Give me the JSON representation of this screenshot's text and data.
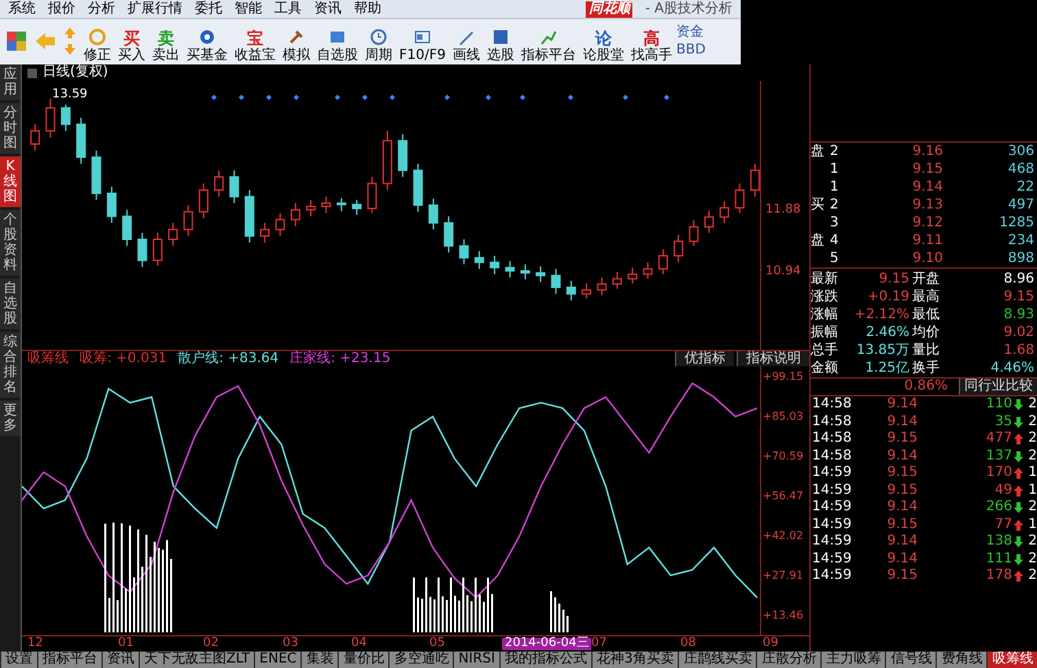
{
  "menu": [
    "系统",
    "报价",
    "分析",
    "扩展行情",
    "委托",
    "智能",
    "工具",
    "资讯",
    "帮助"
  ],
  "logo": "同花顺",
  "app_title": "- A股技术分析",
  "toolbar": [
    {
      "label": "修正"
    },
    {
      "label": "买入",
      "glyph": "买",
      "color": "#e02020"
    },
    {
      "label": "卖出",
      "glyph": "卖",
      "color": "#20a020"
    },
    {
      "label": "买基金"
    },
    {
      "label": "收益宝",
      "glyph": "宝",
      "color": "#e02020"
    },
    {
      "label": "模拟"
    },
    {
      "label": "自选股"
    },
    {
      "label": "周期"
    },
    {
      "label": "F10/F9"
    },
    {
      "label": "画线"
    },
    {
      "label": "选股"
    },
    {
      "label": "指标平台"
    },
    {
      "label": "论股堂",
      "glyph": "论",
      "color": "#2060c0"
    },
    {
      "label": "找高手",
      "glyph": "高",
      "color": "#d01010"
    }
  ],
  "toolbar_cut": [
    "资金",
    "BBD"
  ],
  "side_tabs": [
    {
      "label": "应用",
      "selected": false
    },
    {
      "label": "分时图",
      "selected": false
    },
    {
      "label": "K线图",
      "selected": true
    },
    {
      "label": "个股资料",
      "selected": false
    },
    {
      "label": "自选股",
      "selected": false
    },
    {
      "label": "综合排名",
      "selected": false
    },
    {
      "label": "更多",
      "selected": false
    }
  ],
  "price_chart": {
    "title": "日线(复权)",
    "high_label": "13.59",
    "chart_data": {
      "type": "candlestick",
      "ylim": [
        9.77,
        13.86
      ],
      "yticks": [
        {
          "value": 11.88,
          "label": "11.88"
        },
        {
          "value": 10.94,
          "label": "10.94"
        }
      ],
      "ohlc": [
        [
          12.9,
          13.2,
          12.8,
          13.1
        ],
        [
          13.1,
          13.59,
          13.0,
          13.45
        ],
        [
          13.45,
          13.5,
          13.1,
          13.2
        ],
        [
          13.2,
          13.3,
          12.6,
          12.7
        ],
        [
          12.7,
          12.8,
          12.05,
          12.15
        ],
        [
          12.15,
          12.25,
          11.7,
          11.8
        ],
        [
          11.8,
          11.9,
          11.35,
          11.45
        ],
        [
          11.45,
          11.55,
          11.03,
          11.13
        ],
        [
          11.13,
          11.55,
          11.05,
          11.45
        ],
        [
          11.45,
          11.7,
          11.35,
          11.6
        ],
        [
          11.6,
          11.97,
          11.5,
          11.87
        ],
        [
          11.87,
          12.3,
          11.77,
          12.2
        ],
        [
          12.2,
          12.5,
          12.1,
          12.4
        ],
        [
          12.4,
          12.5,
          12.0,
          12.1
        ],
        [
          12.1,
          12.2,
          11.4,
          11.5
        ],
        [
          11.5,
          11.7,
          11.4,
          11.6
        ],
        [
          11.6,
          11.85,
          11.5,
          11.75
        ],
        [
          11.75,
          12.0,
          11.65,
          11.9
        ],
        [
          11.9,
          12.05,
          11.8,
          11.95
        ],
        [
          11.95,
          12.1,
          11.85,
          12.0
        ],
        [
          12.0,
          12.08,
          11.88,
          11.98
        ],
        [
          11.98,
          12.05,
          11.82,
          11.92
        ],
        [
          11.92,
          12.4,
          11.85,
          12.3
        ],
        [
          12.3,
          13.1,
          12.2,
          12.95
        ],
        [
          12.95,
          13.05,
          12.4,
          12.5
        ],
        [
          12.5,
          12.6,
          11.87,
          11.97
        ],
        [
          11.97,
          12.07,
          11.6,
          11.7
        ],
        [
          11.7,
          11.8,
          11.25,
          11.35
        ],
        [
          11.35,
          11.45,
          11.07,
          11.17
        ],
        [
          11.17,
          11.27,
          11.0,
          11.1
        ],
        [
          11.1,
          11.2,
          10.92,
          11.02
        ],
        [
          11.02,
          11.12,
          10.87,
          10.97
        ],
        [
          10.97,
          11.07,
          10.84,
          10.94
        ],
        [
          10.94,
          11.04,
          10.8,
          10.9
        ],
        [
          10.9,
          11.0,
          10.62,
          10.72
        ],
        [
          10.72,
          10.82,
          10.52,
          10.62
        ],
        [
          10.62,
          10.78,
          10.55,
          10.68
        ],
        [
          10.68,
          10.87,
          10.6,
          10.77
        ],
        [
          10.77,
          10.95,
          10.7,
          10.85
        ],
        [
          10.85,
          11.02,
          10.78,
          10.92
        ],
        [
          10.92,
          11.1,
          10.85,
          11.0
        ],
        [
          11.0,
          11.3,
          10.92,
          11.2
        ],
        [
          11.2,
          11.52,
          11.1,
          11.42
        ],
        [
          11.42,
          11.74,
          11.35,
          11.64
        ],
        [
          11.64,
          11.89,
          11.55,
          11.79
        ],
        [
          11.79,
          12.03,
          11.7,
          11.93
        ],
        [
          11.93,
          12.3,
          11.85,
          12.2
        ],
        [
          12.2,
          12.6,
          12.1,
          12.5
        ]
      ]
    }
  },
  "indicator": {
    "name": "吸筹线",
    "values": [
      {
        "name": "吸筹:",
        "value": "+0.031",
        "color": "#e03030"
      },
      {
        "name": "散户线:",
        "value": "+83.64",
        "color": "#60e0e0"
      },
      {
        "name": "庄家线:",
        "value": "+23.15",
        "color": "#e040e0"
      }
    ],
    "buttons": [
      "优指标",
      "指标说明"
    ],
    "chart_data": {
      "type": "line",
      "ylim": [
        6.56,
        103.09
      ],
      "yticks": [
        {
          "value": 99.15,
          "label": "+99.15"
        },
        {
          "value": 85.03,
          "label": "+85.03"
        },
        {
          "value": 70.59,
          "label": "+70.59"
        },
        {
          "value": 56.47,
          "label": "+56.47"
        },
        {
          "value": 42.02,
          "label": "+42.02"
        },
        {
          "value": 27.91,
          "label": "+27.91"
        },
        {
          "value": 13.46,
          "label": "+13.46"
        }
      ],
      "series": [
        {
          "color": "#60e0e0",
          "values": [
            60,
            52,
            55,
            70,
            95,
            90,
            92,
            60,
            52,
            45,
            70,
            85,
            75,
            50,
            45,
            35,
            25,
            40,
            80,
            85,
            70,
            60,
            75,
            88,
            90,
            88,
            80,
            60,
            32,
            38,
            28,
            30,
            38,
            28,
            20
          ]
        },
        {
          "color": "#d040d0",
          "values": [
            55,
            65,
            60,
            42,
            28,
            22,
            32,
            58,
            78,
            92,
            96,
            82,
            62,
            46,
            32,
            25,
            28,
            40,
            55,
            38,
            27,
            20,
            28,
            42,
            60,
            75,
            88,
            92,
            82,
            72,
            85,
            97,
            92,
            85,
            88
          ]
        }
      ]
    }
  },
  "x_axis": [
    {
      "label": "12",
      "selected": false
    },
    {
      "label": "01",
      "selected": false
    },
    {
      "label": "02",
      "selected": false
    },
    {
      "label": "03",
      "selected": false
    },
    {
      "label": "04",
      "selected": false
    },
    {
      "label": "05",
      "selected": false
    },
    {
      "label": "2014-06-04三",
      "selected": true
    },
    {
      "label": "07",
      "selected": false
    },
    {
      "label": "08",
      "selected": false
    },
    {
      "label": "09",
      "selected": false
    }
  ],
  "order_book": [
    {
      "side_label": "盘",
      "level": "2",
      "price": "9.16",
      "volume": "306"
    },
    {
      "level": "1",
      "price": "9.15",
      "volume": "468"
    },
    {
      "level": "1",
      "price": "9.14",
      "volume": "22"
    },
    {
      "side_label": "买",
      "level": "2",
      "price": "9.13",
      "volume": "497"
    },
    {
      "level": "3",
      "price": "9.12",
      "volume": "1285"
    },
    {
      "side_label": "盘",
      "level": "4",
      "price": "9.11",
      "volume": "234"
    },
    {
      "level": "5",
      "price": "9.10",
      "volume": "898"
    }
  ],
  "stats": [
    {
      "label": "最新",
      "value": "9.15",
      "color": "#e04040"
    },
    {
      "label": "开盘",
      "value": "8.96",
      "color": "#ffffff"
    },
    {
      "label": "涨跌",
      "value": "+0.19",
      "color": "#e04040"
    },
    {
      "label": "最高",
      "value": "9.15",
      "color": "#e04040"
    },
    {
      "label": "涨幅",
      "value": "+2.12%",
      "color": "#e04040"
    },
    {
      "label": "最低",
      "value": "8.93",
      "color": "#30c030"
    },
    {
      "label": "振幅",
      "value": "2.46%",
      "color": "#60e0e0"
    },
    {
      "label": "均价",
      "value": "9.02",
      "color": "#e04040"
    },
    {
      "label": "总手",
      "value": "13.85万",
      "color": "#60e0e0"
    },
    {
      "label": "量比",
      "value": "1.68",
      "color": "#e04040"
    },
    {
      "label": "金额",
      "value": "1.25亿",
      "color": "#60e0e0"
    },
    {
      "label": "换手",
      "value": "4.46%",
      "color": "#60e0e0"
    }
  ],
  "compare": {
    "value": "0.86%",
    "button": "同行业比较"
  },
  "ticks": [
    {
      "time": "14:58",
      "price": "9.14",
      "volume": "110",
      "up": false,
      "column_5": "2"
    },
    {
      "time": "14:58",
      "price": "9.14",
      "volume": "35",
      "up": false,
      "column_5": "2"
    },
    {
      "time": "14:58",
      "price": "9.15",
      "volume": "477",
      "up": true,
      "column_5": "2"
    },
    {
      "time": "14:58",
      "price": "9.14",
      "volume": "137",
      "up": false,
      "column_5": "2"
    },
    {
      "time": "14:59",
      "price": "9.15",
      "volume": "170",
      "up": true,
      "column_5": "1"
    },
    {
      "time": "14:59",
      "price": "9.15",
      "volume": "49",
      "up": true,
      "column_5": "1"
    },
    {
      "time": "14:59",
      "price": "9.14",
      "volume": "266",
      "up": false,
      "column_5": "2"
    },
    {
      "time": "14:59",
      "price": "9.15",
      "volume": "77",
      "up": true,
      "column_5": "1"
    },
    {
      "time": "14:59",
      "price": "9.14",
      "volume": "138",
      "up": false,
      "column_5": "2"
    },
    {
      "time": "14:59",
      "price": "9.14",
      "volume": "111",
      "up": false,
      "column_5": "2"
    },
    {
      "time": "14:59",
      "price": "9.15",
      "volume": "178",
      "up": true,
      "column_5": "2"
    }
  ],
  "bottom_tabs": [
    {
      "label": "设置",
      "selected": false
    },
    {
      "label": "指标平台",
      "selected": false
    },
    {
      "label": "资讯",
      "selected": false
    },
    {
      "label": "天下无敌主图ZLT",
      "selected": false
    },
    {
      "label": "ENEC",
      "selected": false
    },
    {
      "label": "集装",
      "selected": false
    },
    {
      "label": "量价比",
      "selected": false
    },
    {
      "label": "多空通吃",
      "selected": false
    },
    {
      "label": "NIRSI",
      "selected": false
    },
    {
      "label": "我的指标公式",
      "selected": false
    },
    {
      "label": "花神3角买卖",
      "selected": false
    },
    {
      "label": "庄鹊线买卖",
      "selected": false
    },
    {
      "label": "庄散分析",
      "selected": false
    },
    {
      "label": "主力吸筹",
      "selected": false
    },
    {
      "label": "信号线",
      "selected": false
    },
    {
      "label": "费角线",
      "selected": false
    },
    {
      "label": "吸筹线",
      "selected": true
    }
  ]
}
